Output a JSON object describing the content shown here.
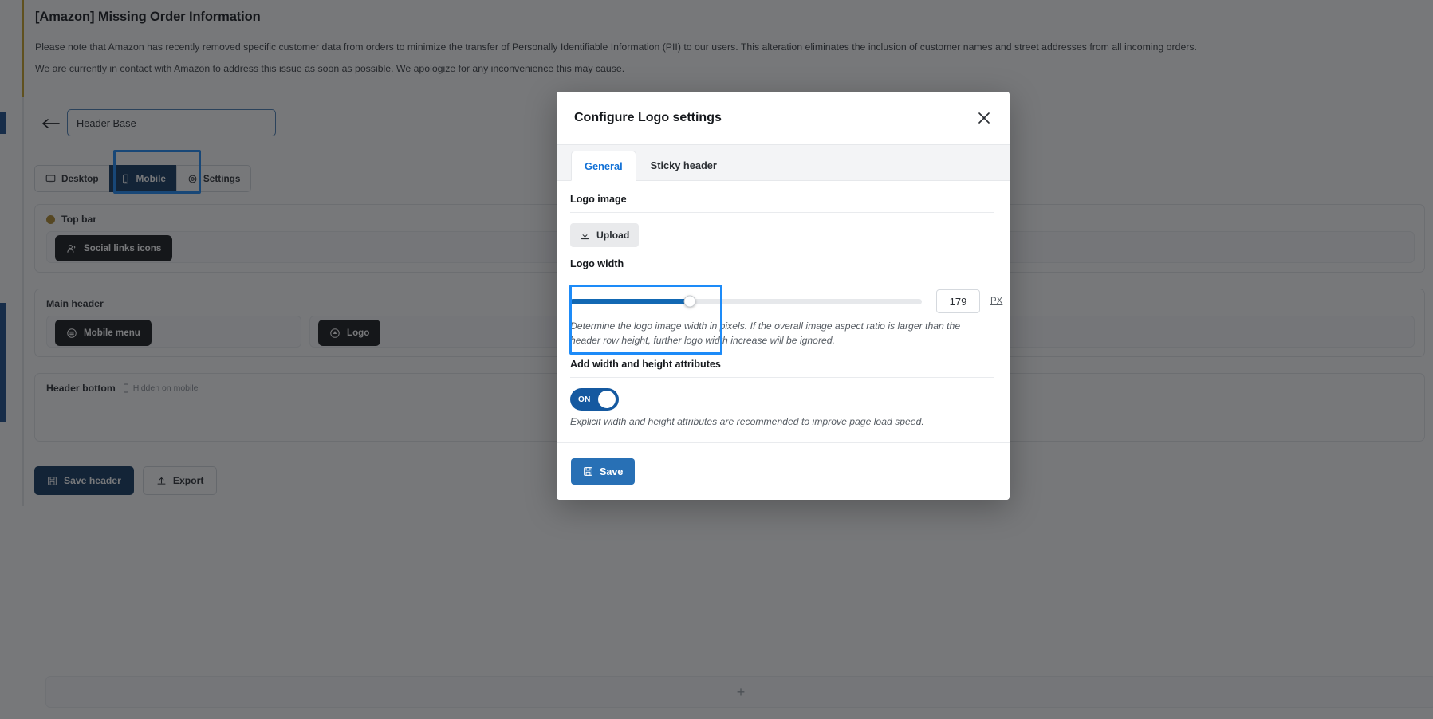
{
  "notice": {
    "title": "[Amazon] Missing Order Information",
    "paragraph_1": "Please note that Amazon has recently removed specific customer data from orders to minimize the transfer of Personally Identifiable Information (PII) to our users. This alteration eliminates the inclusion of customer names and street addresses from all incoming orders.",
    "paragraph_2": "We are currently in contact with Amazon to address this issue as soon as possible. We apologize for any inconvenience this may cause."
  },
  "builder": {
    "header_name": "Header Base",
    "device_tabs": [
      {
        "label": "Desktop",
        "icon": "monitor-icon",
        "active": false
      },
      {
        "label": "Mobile",
        "icon": "phone-icon",
        "active": true
      },
      {
        "label": "Settings",
        "icon": "gear-icon",
        "active": false
      }
    ],
    "rows": [
      {
        "title": "Top bar",
        "dot_color": "#b08a2e",
        "hidden_tag": "",
        "chips": [
          {
            "label": "Social links icons",
            "icon": "users-icon"
          }
        ]
      },
      {
        "title": "Main header",
        "dot_color": "",
        "hidden_tag": "",
        "chips": [
          {
            "label": "Mobile menu",
            "icon": "menu-icon"
          },
          {
            "label": "Logo",
            "icon": "logo-icon"
          }
        ]
      },
      {
        "title": "Header bottom",
        "dot_color": "",
        "hidden_tag": "Hidden on mobile",
        "chips": []
      }
    ],
    "add_symbol": "+",
    "save_header_label": "Save header",
    "export_label": "Export"
  },
  "modal": {
    "title": "Configure Logo settings",
    "close_symbol": "✕",
    "tabs": [
      {
        "label": "General",
        "active": true
      },
      {
        "label": "Sticky header",
        "active": false
      }
    ],
    "logo_image": {
      "label": "Logo image",
      "upload_label": "Upload"
    },
    "logo_width": {
      "label": "Logo width",
      "value": "179",
      "unit": "PX",
      "slider_percent": 34,
      "hint": "Determine the logo image width in pixels. If the overall image aspect ratio is larger than the header row height, further logo width increase will be ignored."
    },
    "width_height_attrs": {
      "label": "Add width and height attributes",
      "toggle_state": "ON",
      "hint": "Explicit width and height attributes are recommended to improve page load speed."
    },
    "save_label": "Save"
  },
  "colors": {
    "accent_blue": "#1d8bf8",
    "tab_active": "#1271d6",
    "primary_dark": "#12385f",
    "slider_fill": "#1268b3",
    "toggle_on": "#1559a0",
    "save_blue": "#2870b5",
    "notice_bar": "#c9a227"
  }
}
